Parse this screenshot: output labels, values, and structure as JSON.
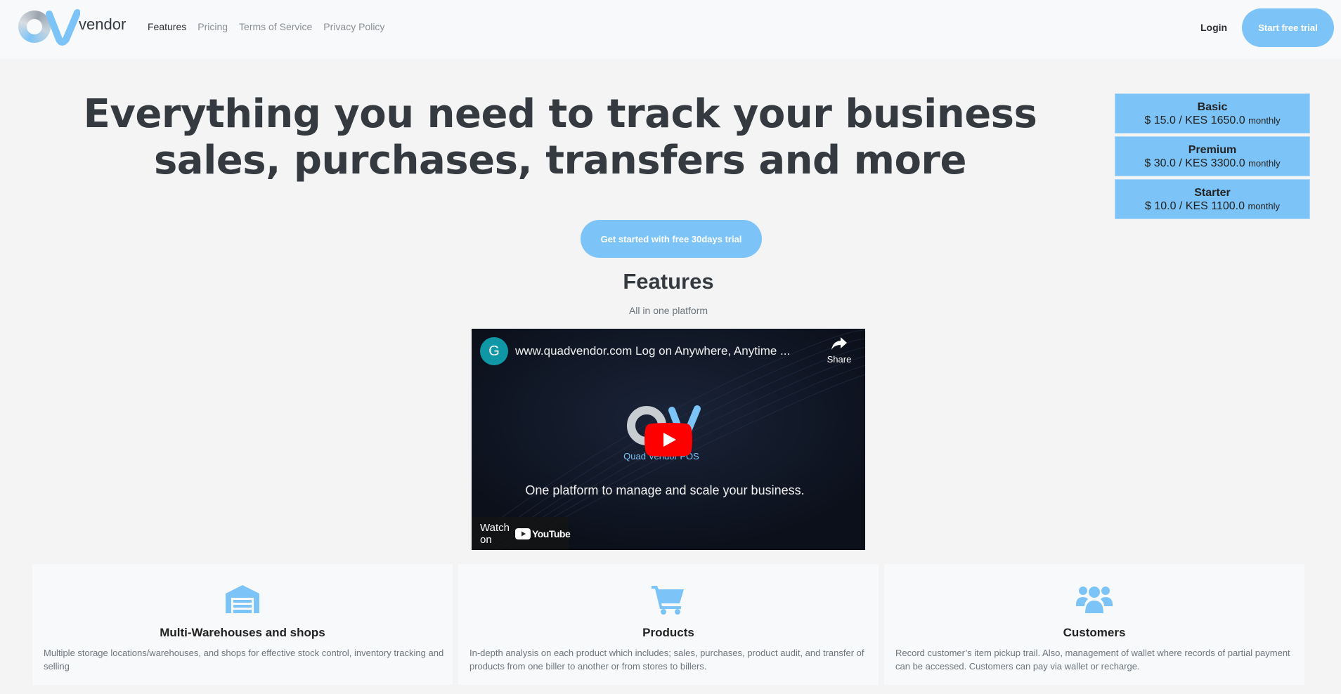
{
  "brand": {
    "name": "vendor",
    "colors": {
      "accent": "#7cc4f7",
      "text": "#343a40",
      "muted": "#6c757d"
    }
  },
  "nav": {
    "items": [
      {
        "label": "Features",
        "active": true
      },
      {
        "label": "Pricing",
        "active": false
      },
      {
        "label": "Terms of Service",
        "active": false
      },
      {
        "label": "Privacy Policy",
        "active": false
      }
    ],
    "login_label": "Login",
    "trial_label": "Start free trial"
  },
  "hero": {
    "title": "Everything you need to track your business sales, purchases, transfers and more",
    "cta_label": "Get started with free 30days trial"
  },
  "plans": [
    {
      "name": "Basic",
      "price": "$ 15.0 / KES 1650.0",
      "period": "monthly"
    },
    {
      "name": "Premium",
      "price": "$ 30.0 / KES 3300.0",
      "period": "monthly"
    },
    {
      "name": "Starter",
      "price": "$ 10.0 / KES 1100.0",
      "period": "monthly"
    }
  ],
  "features": {
    "title": "Features",
    "subtitle": "All in one platform"
  },
  "video": {
    "channel_initial": "G",
    "title": "www.quadvendor.com Log on Anywhere, Anytime ...",
    "share_label": "Share",
    "brand_label": "Quad Vendor POS",
    "tagline": "One platform to manage and scale your business.",
    "watch_label": "Watch on",
    "youtube_label": "YouTube"
  },
  "cards": [
    {
      "icon": "warehouse-icon",
      "title": "Multi-Warehouses and shops",
      "text": "Multiple storage locations/warehouses, and shops for effective stock control, inventory tracking and selling"
    },
    {
      "icon": "cart-icon",
      "title": "Products",
      "text": "In-depth analysis on each product which includes; sales, purchases, product audit, and transfer of products from one biller to another or from stores to billers."
    },
    {
      "icon": "users-icon",
      "title": "Customers",
      "text": "Record customer’s item pickup trail. Also, management of wallet where records of partial payment can be accessed. Customers can pay via wallet or recharge."
    }
  ]
}
